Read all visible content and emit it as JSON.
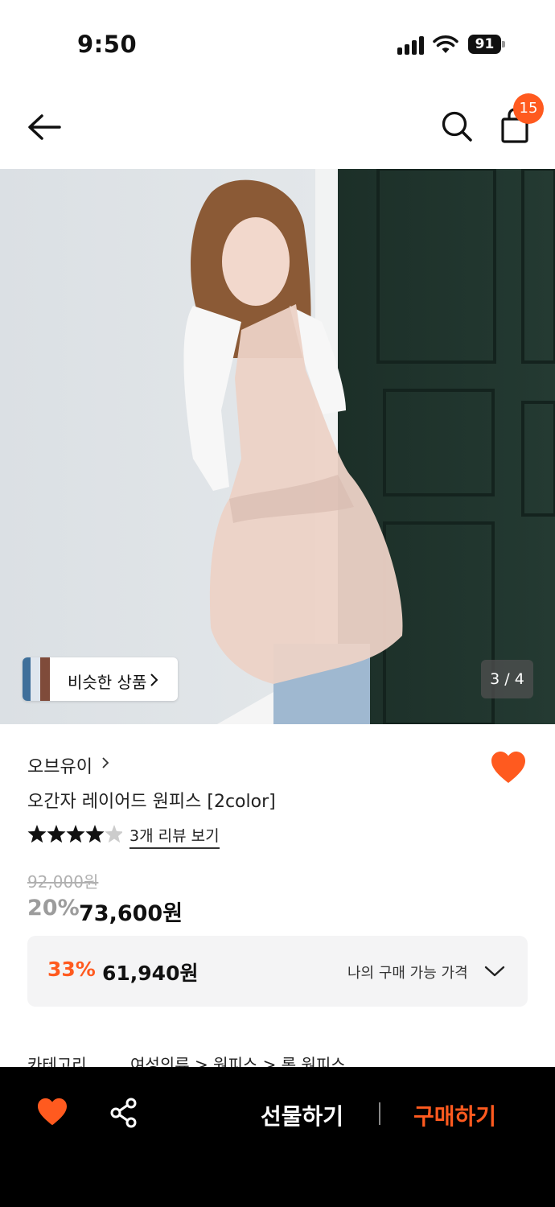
{
  "status_bar": {
    "time": "9:50",
    "battery": "91"
  },
  "nav": {
    "cart_count": "15"
  },
  "gallery": {
    "similar_label": "비슷한 상품",
    "page_indicator": "3 / 4"
  },
  "product": {
    "brand": "오브유이",
    "title": "오간자 레이어드 원피스 [2color]",
    "rating": 4.5,
    "review_link": "3개 리뷰 보기",
    "original_price": "92,000원",
    "discount_rate": "20%",
    "price": "73,600원"
  },
  "my_price": {
    "discount_rate": "33%",
    "price": "61,940원",
    "label": "나의 구매 가능 가격"
  },
  "category": {
    "label": "카테고리",
    "path": "여성의류 > 원피스 > 롱 원피스"
  },
  "bottom_bar": {
    "gift_label": "선물하기",
    "buy_label": "구매하기"
  },
  "colors": {
    "accent": "#ff5a1f",
    "muted": "#9c9c9c"
  }
}
